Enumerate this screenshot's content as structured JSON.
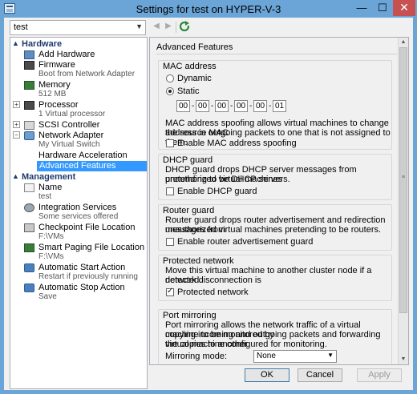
{
  "window": {
    "title": "Settings for test on HYPER-V-3",
    "minimize": "—",
    "maximize": "☐",
    "close": "✕"
  },
  "vm_selector": {
    "value": "test"
  },
  "tree": {
    "hardware_label": "Hardware",
    "management_label": "Management",
    "hardware_items": [
      {
        "label": "Add Hardware",
        "sub": ""
      },
      {
        "label": "Firmware",
        "sub": "Boot from Network Adapter"
      },
      {
        "label": "Memory",
        "sub": "512 MB"
      },
      {
        "label": "Processor",
        "sub": "1 Virtual processor"
      },
      {
        "label": "SCSI Controller",
        "sub": ""
      },
      {
        "label": "Network Adapter",
        "sub": "My Virtual Switch"
      }
    ],
    "network_children": [
      {
        "label": "Hardware Acceleration"
      },
      {
        "label": "Advanced Features"
      }
    ],
    "management_items": [
      {
        "label": "Name",
        "sub": "test"
      },
      {
        "label": "Integration Services",
        "sub": "Some services offered"
      },
      {
        "label": "Checkpoint File Location",
        "sub": "F:\\VMs"
      },
      {
        "label": "Smart Paging File Location",
        "sub": "F:\\VMs"
      },
      {
        "label": "Automatic Start Action",
        "sub": "Restart if previously running"
      },
      {
        "label": "Automatic Stop Action",
        "sub": "Save"
      }
    ]
  },
  "panel": {
    "title": "Advanced Features",
    "mac": {
      "group_title": "MAC address",
      "dynamic_label": "Dynamic",
      "static_label": "Static",
      "selected": "Static",
      "octets": [
        "00",
        "00",
        "00",
        "00",
        "00",
        "01"
      ],
      "description": [
        "MAC address spoofing allows virtual machines to change the source MAC",
        "address in outgoing packets to one that is not assigned to them."
      ],
      "spoofing_label": "Enable MAC address spoofing",
      "spoofing_checked": false
    },
    "dhcp": {
      "group_title": "DHCP guard",
      "description": [
        "DHCP guard drops DHCP server messages from unauthorized virtual machines",
        "pretending to be DHCP servers."
      ],
      "checkbox_label": "Enable DHCP guard",
      "checked": false
    },
    "router": {
      "group_title": "Router guard",
      "description": [
        "Router guard drops router advertisement and redirection messages from",
        "unauthorized virtual machines pretending to be routers."
      ],
      "checkbox_label": "Enable router advertisement guard",
      "checked": false
    },
    "protected": {
      "group_title": "Protected network",
      "description": [
        "Move this virtual machine to another cluster node if a network disconnection is",
        "detected."
      ],
      "checkbox_label": "Protected network",
      "checked": true
    },
    "mirroring": {
      "group_title": "Port mirroring",
      "description": [
        "Port mirroring allows the network traffic of a virtual machine to be monitored by",
        "copying incoming and outgoing packets and forwarding the copies to another",
        "virtual machine configured for monitoring."
      ],
      "mode_label": "Mirroring mode:",
      "mode_value": "None"
    }
  },
  "buttons": {
    "ok": "OK",
    "cancel": "Cancel",
    "apply": "Apply"
  }
}
